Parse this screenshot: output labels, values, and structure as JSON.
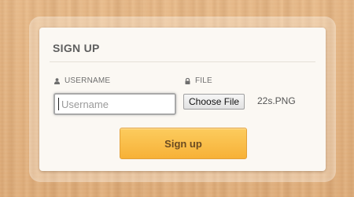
{
  "form": {
    "title": "SIGN UP",
    "username_label": "USERNAME",
    "username_placeholder": "Username",
    "username_value": "",
    "file_label": "FILE",
    "choose_file_label": "Choose File",
    "file_name": "22s.PNG",
    "submit_label": "Sign up"
  },
  "icons": {
    "username": "user-icon",
    "file": "lock-icon"
  },
  "colors": {
    "wood_background": "#e2b17f",
    "card_background": "#fbf8f3",
    "button_top": "#fccc5e",
    "button_bottom": "#f7b137",
    "button_text": "#6b4b21",
    "title_text": "#5f5f5f"
  }
}
